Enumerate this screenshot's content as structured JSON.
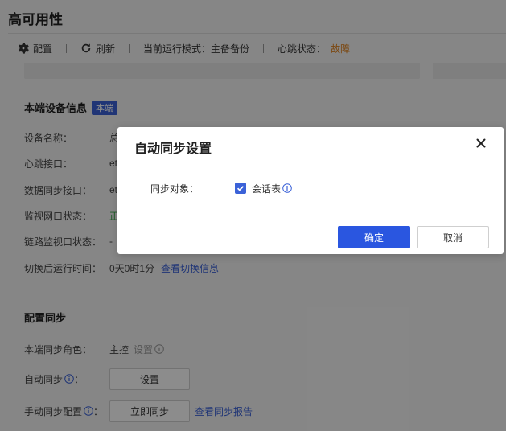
{
  "page": {
    "title": "高可用性"
  },
  "toolbar": {
    "config_label": "配置",
    "refresh_label": "刷新",
    "mode_text": "当前运行模式：主备备份",
    "heartbeat_label": "心跳状态：",
    "heartbeat_value": "故障"
  },
  "local_device": {
    "title": "本端设备信息",
    "badge": "本端",
    "rows": [
      {
        "label": "设备名称：",
        "value": "总"
      },
      {
        "label": "心跳接口：",
        "value": "et"
      },
      {
        "label": "数据同步接口：",
        "value": "et"
      },
      {
        "label": "监视网口状态：",
        "value": "正"
      },
      {
        "label": "链路监视口状态：",
        "value": "-"
      }
    ],
    "switch_time_label": "切换后运行时间：",
    "switch_time_value": "0天0时1分",
    "switch_link": "查看切换信息"
  },
  "config_sync": {
    "title": "配置同步",
    "role_label": "本端同步角色：",
    "role_value": "主控",
    "role_setting": "设置",
    "auto_sync_label": "自动同步",
    "auto_sync_suffix": "：",
    "auto_sync_button": "设置",
    "manual_sync_label": "手动同步配置",
    "manual_sync_suffix": "：",
    "manual_sync_button": "立即同步",
    "report_link": "查看同步报告"
  },
  "modal": {
    "title": "自动同步设置",
    "sync_target_label": "同步对象：",
    "session_table_label": "会话表",
    "session_table_checked": true,
    "confirm_label": "确定",
    "cancel_label": "取消"
  },
  "colors": {
    "accent": "#2a56e0",
    "badge": "#3b62d8",
    "fault": "#e0801a",
    "ok": "#3aa64a"
  }
}
